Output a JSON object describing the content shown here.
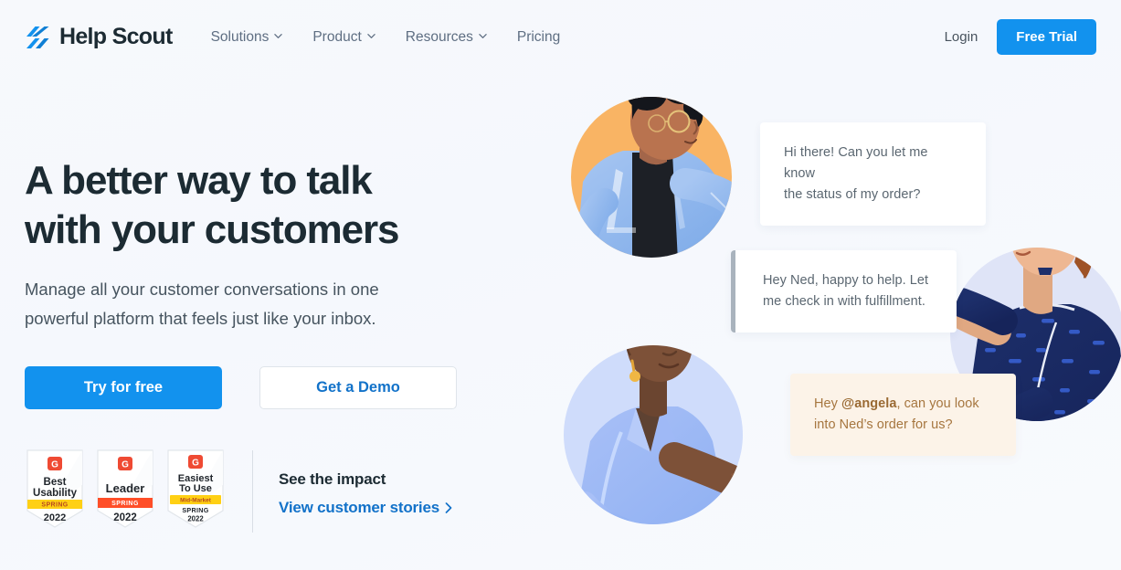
{
  "brand": {
    "name": "Help Scout",
    "logo_icon": "helpscout-slashes-logo",
    "accent_color": "#1292ee"
  },
  "nav": {
    "links": [
      {
        "label": "Solutions",
        "has_dropdown": true,
        "icon": "chevron-down-icon"
      },
      {
        "label": "Product",
        "has_dropdown": true,
        "icon": "chevron-down-icon"
      },
      {
        "label": "Resources",
        "has_dropdown": true,
        "icon": "chevron-down-icon"
      },
      {
        "label": "Pricing",
        "has_dropdown": false,
        "icon": ""
      }
    ],
    "login_label": "Login",
    "free_trial_label": "Free Trial"
  },
  "hero": {
    "headline": "A better way to talk with your customers",
    "subhead": "Manage all your customer conversations in one powerful platform that feels just like your inbox.",
    "primary_cta": "Try for free",
    "secondary_cta": "Get a Demo"
  },
  "badges": [
    {
      "source": "G2",
      "title_line1": "Best",
      "title_line2": "Usability",
      "ribbon": "SPRING",
      "ribbon_color": "#ffd014",
      "ribbon_text_color": "#b8491f",
      "segment": "",
      "year": "2022"
    },
    {
      "source": "G2",
      "title_line1": "Leader",
      "title_line2": "",
      "ribbon": "SPRING",
      "ribbon_color": "#ff4e28",
      "ribbon_text_color": "#ffffff",
      "segment": "",
      "year": "2022"
    },
    {
      "source": "G2",
      "title_line1": "Easiest",
      "title_line2": "To Use",
      "ribbon": "Mid-Market",
      "ribbon_color": "#ffd014",
      "ribbon_text_color": "#b8491f",
      "segment": "SPRING",
      "year": "2022"
    }
  ],
  "impact": {
    "title": "See the impact",
    "link_label": "View customer stories",
    "link_icon": "chevron-right-icon"
  },
  "illustration": {
    "people": [
      {
        "name": "man-with-glasses",
        "description": "Man with glasses, dark curly hair, light blue blazer over black top",
        "circle_color": "#f9b464"
      },
      {
        "name": "woman-auburn-hair",
        "description": "Woman with auburn bob, navy patterned sweater, pointing",
        "circle_color": "#dfe4f7"
      },
      {
        "name": "woman-gold-earring",
        "description": "Woman with short dark hair, gold earring, light blue top, open hand",
        "circle_color": "#cfdcfb"
      }
    ],
    "bubbles": [
      {
        "id": "bubble-customer-question",
        "line1": "Hi there! Can you let me know",
        "line2": "the status of my order?",
        "style": "white",
        "background": "#ffffff",
        "text_color": "#5b6771"
      },
      {
        "id": "bubble-agent-reply",
        "line1": "Hey Ned, happy to help. Let",
        "line2": "me check in with fulfillment.",
        "style": "white-with-left-bar",
        "background": "#ffffff",
        "text_color": "#5b6771",
        "bar_color": "#a9b3bd"
      },
      {
        "id": "bubble-internal-note",
        "prefix": "Hey ",
        "mention": "@angela",
        "line1_suffix": ", can you look",
        "line2": "into Ned’s order for us?",
        "style": "note",
        "background": "#fcf3e8",
        "text_color": "#a6763f"
      }
    ]
  }
}
